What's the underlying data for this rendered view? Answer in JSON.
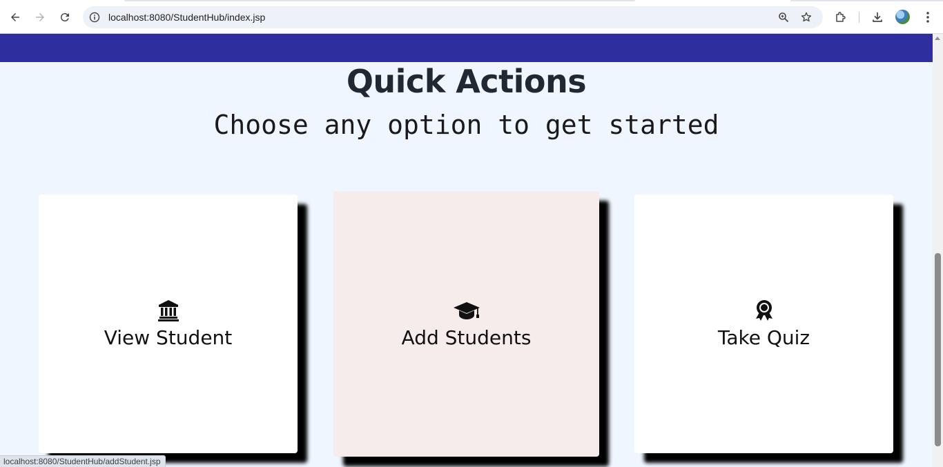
{
  "browser": {
    "url": "localhost:8080/StudentHub/index.jsp",
    "status_url": "localhost:8080/StudentHub/addStudent.jsp"
  },
  "page": {
    "title": "Quick Actions",
    "subtitle": "Choose any option to get started"
  },
  "cards": [
    {
      "label": "View Student",
      "icon": "bank-icon"
    },
    {
      "label": "Add Students",
      "icon": "graduation-cap-icon"
    },
    {
      "label": "Take Quiz",
      "icon": "award-icon"
    }
  ],
  "colors": {
    "banner": "#2e2e9e",
    "page_background": "#eff6ff",
    "active_card": "#f6eceb"
  }
}
